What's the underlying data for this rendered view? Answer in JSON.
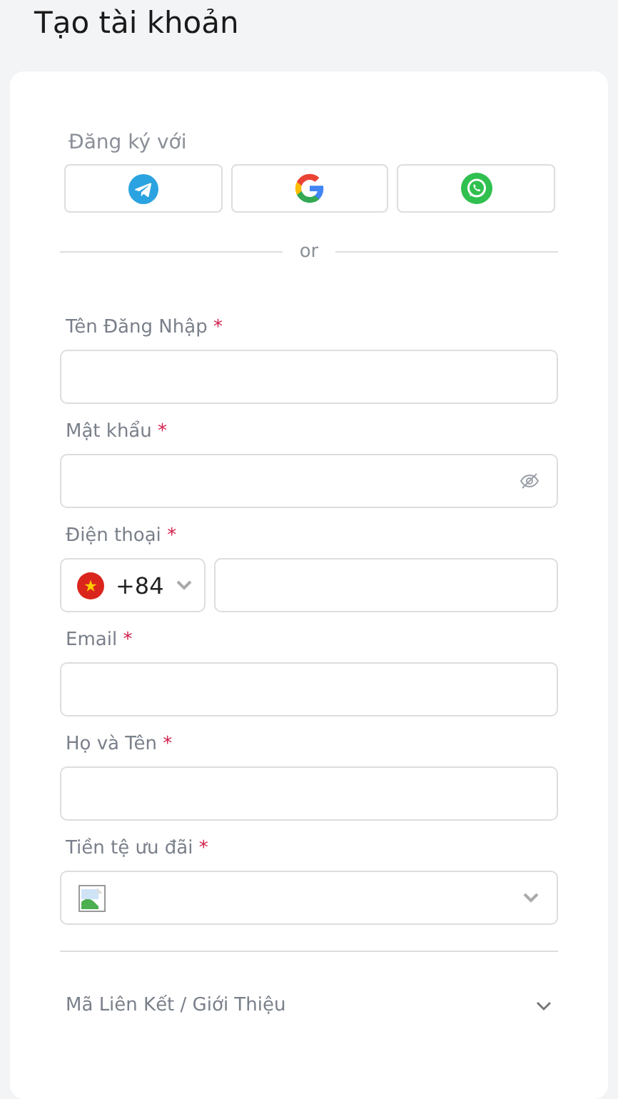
{
  "title": "Tạo tài khoản",
  "social": {
    "label": "Đăng ký với",
    "providers": [
      {
        "kind": "telegram"
      },
      {
        "kind": "google"
      },
      {
        "kind": "whatsapp"
      }
    ]
  },
  "separator": "or",
  "fields": [
    {
      "kind": "text",
      "label": "Tên Đăng Nhập",
      "required_mark": "*"
    },
    {
      "kind": "password",
      "label": "Mật khẩu",
      "required_mark": "*"
    },
    {
      "kind": "phone",
      "label": "Điện thoại",
      "required_mark": "*",
      "country_code": "+84"
    },
    {
      "kind": "text",
      "label": "Email",
      "required_mark": "*"
    },
    {
      "kind": "text",
      "label": "Họ và Tên",
      "required_mark": "*"
    },
    {
      "kind": "select",
      "label": "Tiền tệ ưu đãi",
      "required_mark": "*"
    }
  ],
  "referral": {
    "label": "Mã Liên Kết / Giới Thiệu",
    "expanded": false
  }
}
